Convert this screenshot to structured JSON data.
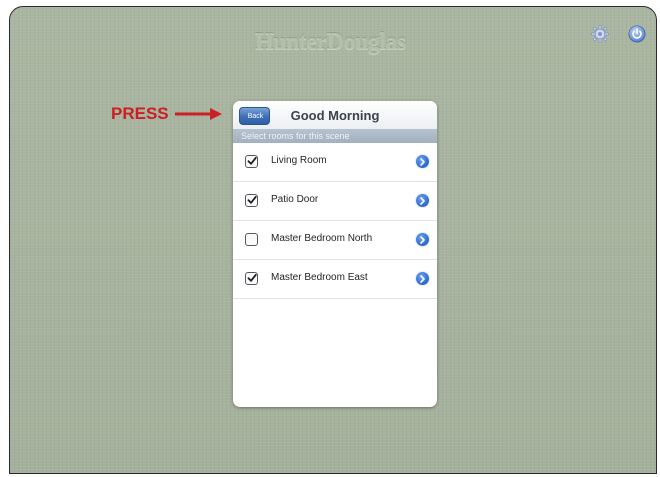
{
  "header": {
    "brand": "HunterDouglas",
    "settings_icon": "gear-icon",
    "power_icon": "power-icon"
  },
  "panel": {
    "back_label": "Back",
    "title": "Good Morning",
    "subtitle": "Select rooms for this scene",
    "rooms": [
      {
        "label": "Living Room",
        "checked": true
      },
      {
        "label": "Patio Door",
        "checked": true
      },
      {
        "label": "Master Bedroom North",
        "checked": false
      },
      {
        "label": "Master Bedroom East",
        "checked": true
      }
    ]
  },
  "annotation": {
    "label": "PRESS",
    "color": "#cc1f24"
  },
  "colors": {
    "background": "#a8b49f",
    "accent": "#3d6fb7",
    "disclosure": "#2f6ed6"
  }
}
